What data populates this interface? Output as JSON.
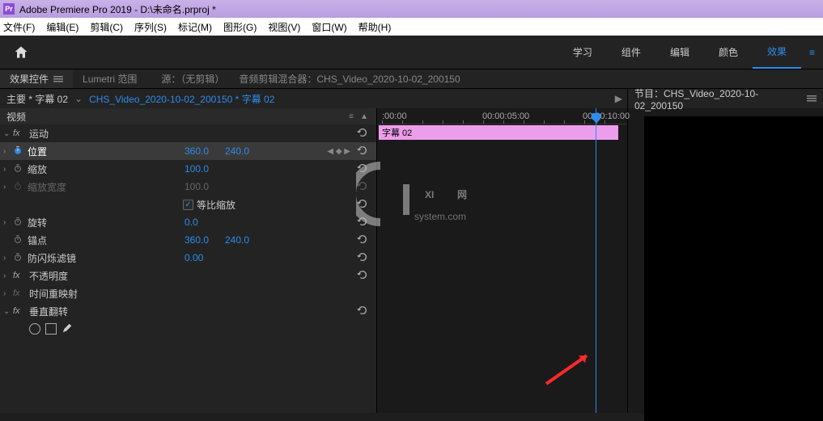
{
  "title_bar": {
    "app": "Adobe Premiere Pro 2019",
    "doc": "D:\\未命名.prproj *"
  },
  "menu": [
    "文件(F)",
    "编辑(E)",
    "剪辑(C)",
    "序列(S)",
    "标记(M)",
    "图形(G)",
    "视图(V)",
    "窗口(W)",
    "帮助(H)"
  ],
  "workspaces": [
    "学习",
    "组件",
    "编辑",
    "颜色",
    "效果"
  ],
  "workspace_active": "效果",
  "panel_tabs": {
    "active": "效果控件",
    "items": [
      "效果控件",
      "Lumetri 范围"
    ],
    "source_label": "源：（无剪辑）",
    "mixer_label": "音频剪辑混合器：CHS_Video_2020-10-02_200150"
  },
  "clip_header": {
    "main": "主要 * 字幕 02",
    "sub": "CHS_Video_2020-10-02_200150 * 字幕 02"
  },
  "video_section": "视频",
  "timeline": {
    "t0": ":00:00",
    "t1": "00:00:05:00",
    "t2": "00:00:10:00",
    "clip": "字幕 02"
  },
  "effects": {
    "motion": "运动",
    "position": {
      "label": "位置",
      "x": "360.0",
      "y": "240.0"
    },
    "scale": {
      "label": "缩放",
      "v": "100.0"
    },
    "scale_width": {
      "label": "缩放宽度",
      "v": "100.0"
    },
    "uniform": {
      "label": "等比缩放"
    },
    "rotation": {
      "label": "旋转",
      "v": "0.0"
    },
    "anchor": {
      "label": "锚点",
      "x": "360.0",
      "y": "240.0"
    },
    "flicker": {
      "label": "防闪烁滤镜",
      "v": "0.00"
    },
    "opacity": "不透明度",
    "remap": "时间重映射",
    "vflip": "垂直翻转"
  },
  "right_panel": {
    "prefix": "节目：",
    "name": "CHS_Video_2020-10-02_200150"
  },
  "watermark": {
    "brand": "XI网",
    "sub": "system.com"
  }
}
